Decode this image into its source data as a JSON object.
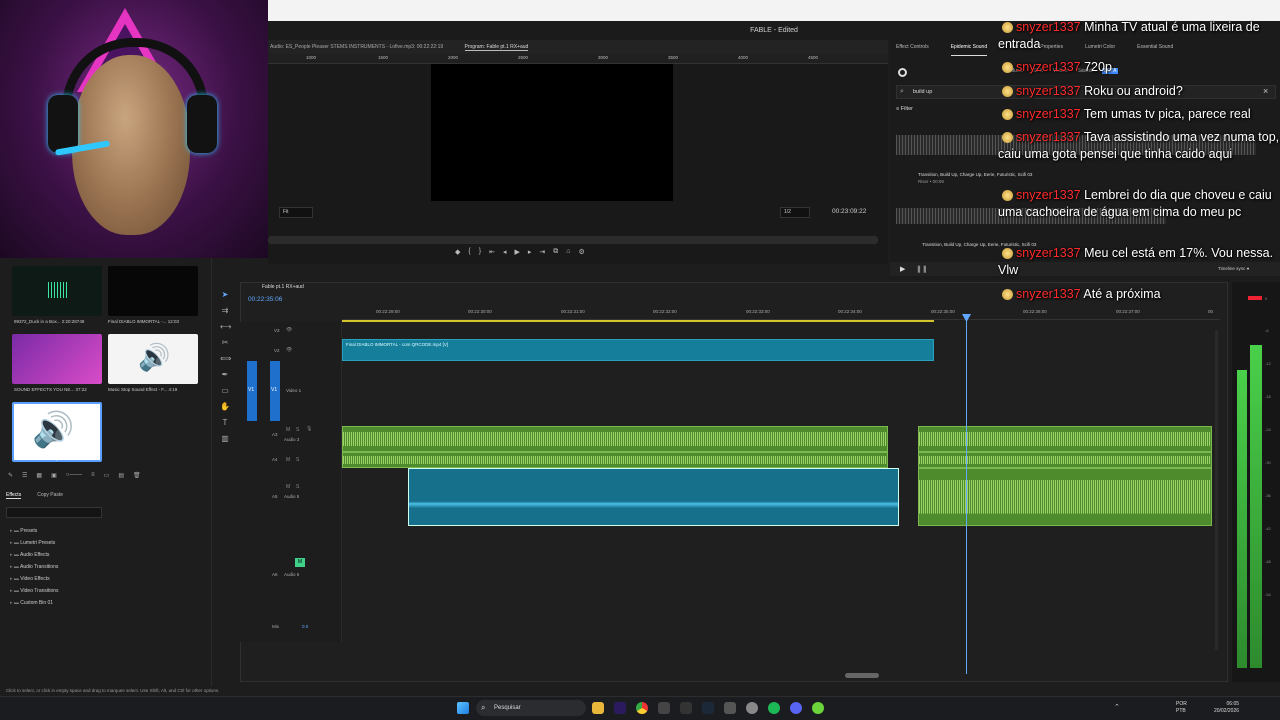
{
  "window": {
    "app_title": "FABLE - Edited"
  },
  "source_monitor": {
    "label": "Audio: ES_People Pleaser STEMS INSTRUMENTS - Lofive.mp3: 00:22:22:19",
    "program_tab": "Program: Fable pt.1 RX+aud"
  },
  "program_monitor": {
    "ruler": [
      "1000",
      "1500",
      "2000",
      "2500",
      "3000",
      "3500",
      "4000",
      "4500"
    ],
    "fit": "Fit",
    "ratio": "1/2",
    "timecode": "00:23:09:22"
  },
  "right_panel": {
    "tabs": [
      "Effect Controls",
      "Epidemic Sound",
      "Text",
      "Properties",
      "Lumetri Color",
      "Essential Sound"
    ],
    "active_tab": "Epidemic Sound",
    "subtabs": [
      "Music",
      "SFX",
      "Voices",
      "Saved"
    ],
    "beta": "BETA",
    "search_value": "build up",
    "filter": "Filter",
    "item1_title": "Transition, Build Up, Charge Up, Eerie, Futuristic, Scifi 03",
    "item1_sub": "Riser • 00:09",
    "item2_title": "Transition, Build Up, Charge Up, Eerie, Futuristic, Scifi 03",
    "timeline_sync": "Timeline sync"
  },
  "project_bin": {
    "items": [
      {
        "name": "99372_Duck in a Box...",
        "duration": "2:20:28748"
      },
      {
        "name": "Final DIABLO IMMORTAL -...",
        "duration": "12:03"
      },
      {
        "name": "SOUND EFFECTS YOU NE...",
        "duration": "37:22"
      },
      {
        "name": "Music Stop Sound Effect - F...",
        "duration": "4:19"
      },
      {
        "name": "Riser Sound Effect.mp4",
        "duration": "5:04"
      }
    ]
  },
  "effects_panel": {
    "tabs": [
      "Effects",
      "Copy Paste"
    ],
    "folders": [
      "Presets",
      "Lumetri Presets",
      "Audio Effects",
      "Audio Transitions",
      "Video Effects",
      "Video Transitions",
      "Custom Bin 01"
    ]
  },
  "timeline": {
    "sequence_tab": "Fable pt.1 RX+aud",
    "timecode": "00:22:35:06",
    "ruler": [
      "00:22:29:00",
      "00:22:30:00",
      "00:22:31:00",
      "00:22:32:00",
      "00:22:33:00",
      "00:22:34:00",
      "00:22:35:00",
      "00:22:36:00",
      "00:22:37:00",
      "00"
    ],
    "tracks": {
      "v3": "V3",
      "v2": "V2",
      "v1": "V1",
      "video1": "Video 1",
      "a3": "A3",
      "audio3": "Audio 3",
      "a4": "A4",
      "a5": "A5",
      "audio5": "Audio 5",
      "a6": "A6",
      "audio6": "Audio 6",
      "mix": "Mix",
      "mix_value": "0.0"
    },
    "video_clip": "Final DIABLO IMMORTAL - com QRCODE.mp4 [V]"
  },
  "meters": {
    "db_labels": [
      "0",
      "-6",
      "-12",
      "-18",
      "-24",
      "-30",
      "-36",
      "-42",
      "-48",
      "-54"
    ]
  },
  "status_bar": "Click to select, or click in empty space and drag to marquee select. Use Shift, Alt, and Ctrl for other options.",
  "taskbar": {
    "search": "Pesquisar",
    "lang1": "POR",
    "lang2": "PTB",
    "time": "06:05",
    "date": "20/02/2026"
  },
  "chat": [
    {
      "user": "snyzer1337",
      "text": "Minha TV atual é uma lixeira de entrada"
    },
    {
      "user": "snyzer1337",
      "text": "720p"
    },
    {
      "user": "snyzer1337",
      "text": "Roku ou android?"
    },
    {
      "user": "snyzer1337",
      "text": "Tem umas tv pica, parece real"
    },
    {
      "user": "snyzer1337",
      "text": "Tava assistindo uma vez numa top, caiu uma gota pensei que tinha caido aqui"
    },
    {
      "user": "snyzer1337",
      "text": "Lembrei do dia que choveu e caiu uma cachoeira de água em cima do meu pc"
    },
    {
      "user": "snyzer1337",
      "text": "Meu cel está em 17%. Vou nessa. Vlw"
    },
    {
      "user": "snyzer1337",
      "text": "Até a próxima"
    }
  ]
}
